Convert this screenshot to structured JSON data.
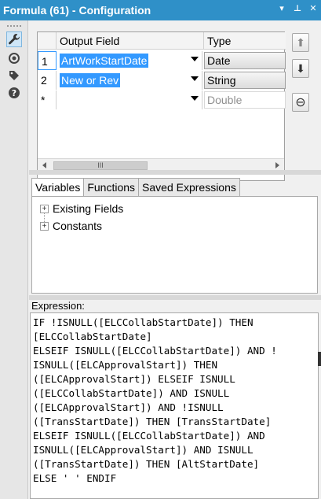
{
  "window": {
    "title": "Formula (61) - Configuration",
    "controls": [
      "▾",
      "⊥",
      "✕"
    ]
  },
  "tools": [
    {
      "name": "wrench-icon",
      "glyph": "🔧"
    },
    {
      "name": "connection-icon",
      "glyph": "◉"
    },
    {
      "name": "tag-icon",
      "glyph": "◆"
    },
    {
      "name": "help-icon",
      "glyph": "?"
    }
  ],
  "grid": {
    "columns": [
      "Output Field",
      "Type"
    ],
    "rows": [
      {
        "num": "1",
        "field": "ArtWorkStartDate",
        "type": "Date"
      },
      {
        "num": "2",
        "field": "New or Rev",
        "type": "String"
      },
      {
        "num": "*",
        "field": "",
        "type": "Double"
      }
    ],
    "scroll_thumb": "III"
  },
  "side_buttons": {
    "up": "⬆",
    "down": "⬇",
    "remove": "⊖"
  },
  "tabs": [
    "Variables",
    "Functions",
    "Saved Expressions"
  ],
  "tree": [
    "Existing Fields",
    "Constants"
  ],
  "expression": {
    "label": "Expression:",
    "text": "IF !ISNULL([ELCCollabStartDate]) THEN\n[ELCCollabStartDate]\nELSEIF ISNULL([ELCCollabStartDate]) AND !\nISNULL([ELCApprovalStart]) THEN\n([ELCApprovalStart]) ELSEIF ISNULL\n([ELCCollabStartDate]) AND ISNULL\n([ELCApprovalStart]) AND !ISNULL\n([TransStartDate]) THEN [TransStartDate]\nELSEIF ISNULL([ELCCollabStartDate]) AND\nISNULL([ELCApprovalStart]) AND ISNULL\n([TransStartDate]) THEN [AltStartDate]\nELSE ' ' ENDIF"
  },
  "colors": {
    "titlebar": "#2f90c8",
    "selection": "#3399ff"
  }
}
